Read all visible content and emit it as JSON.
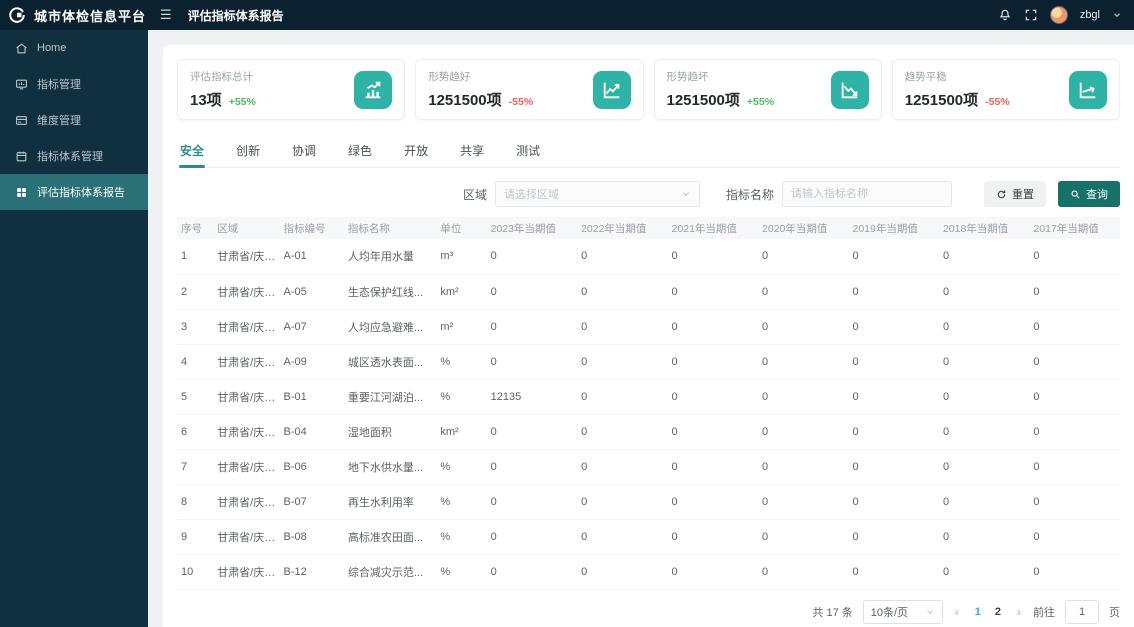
{
  "colors": {
    "topbar_bg": "#0b2130",
    "sidebar_bg": "#102f3f",
    "active_item": "#2a7177",
    "icon_teal": "#2fb3a6",
    "btn_teal": "#187168",
    "green": "#52b966",
    "red": "#f25f5f",
    "page_active": "#409eff"
  },
  "header": {
    "app_title": "城市体检信息平台",
    "breadcrumb": "评估指标体系报告",
    "username": "zbgl",
    "icons": [
      "bell-icon",
      "fullscreen-icon"
    ]
  },
  "sidebar": {
    "items": [
      {
        "label": "Home",
        "icon": "home-icon",
        "active": false
      },
      {
        "label": "指标管理",
        "icon": "monitor-chart-icon",
        "active": false
      },
      {
        "label": "维度管理",
        "icon": "card-icon",
        "active": false
      },
      {
        "label": "指标体系管理",
        "icon": "calendar-icon",
        "active": false
      },
      {
        "label": "评估指标体系报告",
        "icon": "grid-icon",
        "active": true
      }
    ]
  },
  "stats": [
    {
      "label": "评估指标总计",
      "value": "13项",
      "delta": "+55%",
      "trend": "up",
      "icon": "bar-chart-up-icon"
    },
    {
      "label": "形势趋好",
      "value": "1251500项",
      "delta": "-55%",
      "trend": "down",
      "icon": "line-chart-up-icon"
    },
    {
      "label": "形势趋坏",
      "value": "1251500项",
      "delta": "+55%",
      "trend": "up",
      "icon": "line-chart-down-icon"
    },
    {
      "label": "趋势平稳",
      "value": "1251500项",
      "delta": "-55%",
      "trend": "down",
      "icon": "trend-flat-icon"
    }
  ],
  "tabs": [
    {
      "label": "安全",
      "active": true
    },
    {
      "label": "创新",
      "active": false
    },
    {
      "label": "协调",
      "active": false
    },
    {
      "label": "绿色",
      "active": false
    },
    {
      "label": "开放",
      "active": false
    },
    {
      "label": "共享",
      "active": false
    },
    {
      "label": "测试",
      "active": false
    }
  ],
  "filters": {
    "region_label": "区域",
    "region_placeholder": "请选择区域",
    "indicator_label": "指标名称",
    "indicator_placeholder": "请输入指标名称",
    "reset_label": "重置",
    "query_label": "查询"
  },
  "table": {
    "columns": [
      "序号",
      "区域",
      "指标编号",
      "指标名称",
      "单位",
      "2023年当期值",
      "2022年当期值",
      "2021年当期值",
      "2020年当期值",
      "2019年当期值",
      "2018年当期值",
      "2017年当期值"
    ],
    "rows": [
      [
        "1",
        "甘肃省/庆阳...",
        "A-01",
        "人均年用水量",
        "m³",
        "0",
        "0",
        "0",
        "0",
        "0",
        "0",
        "0"
      ],
      [
        "2",
        "甘肃省/庆阳...",
        "A-05",
        "生态保护红线...",
        "km²",
        "0",
        "0",
        "0",
        "0",
        "0",
        "0",
        "0"
      ],
      [
        "3",
        "甘肃省/庆阳...",
        "A-07",
        "人均应急避难...",
        "m²",
        "0",
        "0",
        "0",
        "0",
        "0",
        "0",
        "0"
      ],
      [
        "4",
        "甘肃省/庆阳...",
        "A-09",
        "城区透水表面...",
        "%",
        "0",
        "0",
        "0",
        "0",
        "0",
        "0",
        "0"
      ],
      [
        "5",
        "甘肃省/庆阳...",
        "B-01",
        "重要江河湖泊...",
        "%",
        "12135",
        "0",
        "0",
        "0",
        "0",
        "0",
        "0"
      ],
      [
        "6",
        "甘肃省/庆阳...",
        "B-04",
        "湿地面积",
        "km²",
        "0",
        "0",
        "0",
        "0",
        "0",
        "0",
        "0"
      ],
      [
        "7",
        "甘肃省/庆阳...",
        "B-06",
        "地下水供水量...",
        "%",
        "0",
        "0",
        "0",
        "0",
        "0",
        "0",
        "0"
      ],
      [
        "8",
        "甘肃省/庆阳...",
        "B-07",
        "再生水利用率",
        "%",
        "0",
        "0",
        "0",
        "0",
        "0",
        "0",
        "0"
      ],
      [
        "9",
        "甘肃省/庆阳...",
        "B-08",
        "高标准农田面...",
        "%",
        "0",
        "0",
        "0",
        "0",
        "0",
        "0",
        "0"
      ],
      [
        "10",
        "甘肃省/庆阳...",
        "B-12",
        "综合减灾示范...",
        "%",
        "0",
        "0",
        "0",
        "0",
        "0",
        "0",
        "0"
      ]
    ]
  },
  "pagination": {
    "total_text": "共 17 条",
    "page_size": "10条/页",
    "pages": [
      "1",
      "2"
    ],
    "active_page": "1",
    "prev": "‹",
    "next": "›",
    "goto_label": "前往",
    "goto_value": "1",
    "page_suffix": "页"
  }
}
